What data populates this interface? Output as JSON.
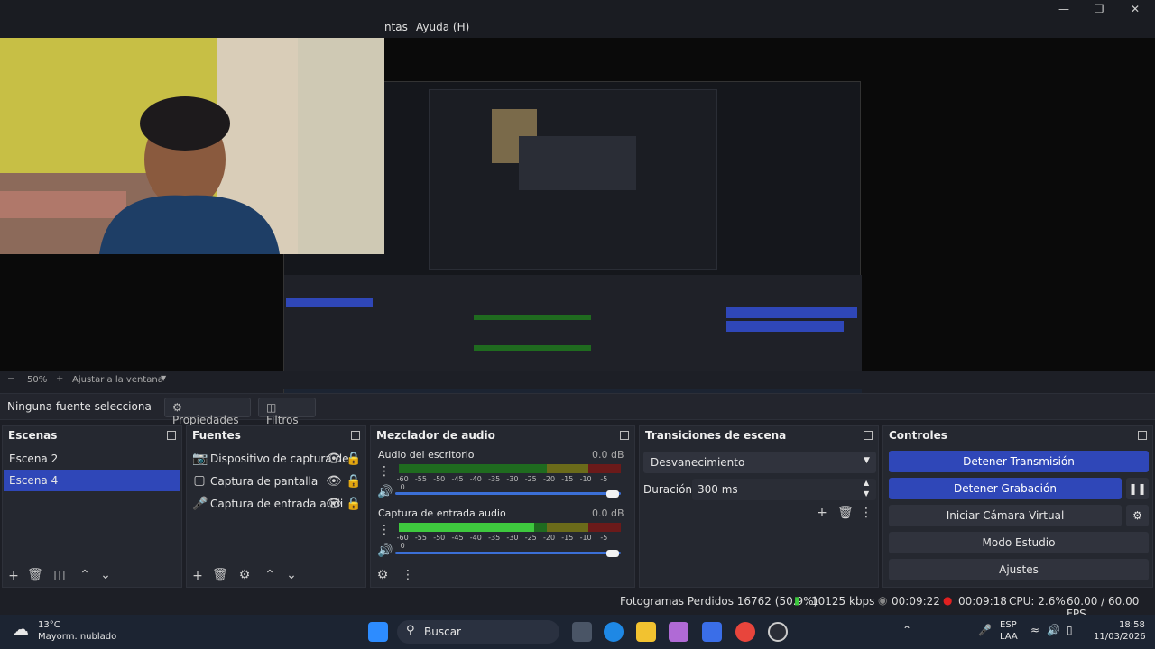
{
  "menu": {
    "partial_windows": "ntas",
    "help": "Ayuda (H)"
  },
  "zoom": {
    "value": "50%",
    "fit_label": "Ajustar a la ventana"
  },
  "source_bar": {
    "no_source": "Ninguna fuente selecciona",
    "properties": "Propiedades",
    "filters": "Filtros"
  },
  "scenes": {
    "title": "Escenas",
    "items": [
      "Escena 2",
      "Escena 4"
    ],
    "selected": "Escena 4"
  },
  "sources": {
    "title": "Fuentes",
    "items": [
      {
        "label": "Dispositivo de captura de",
        "icon": "camera-icon"
      },
      {
        "label": "Captura de pantalla",
        "icon": "monitor-icon"
      },
      {
        "label": "Captura de entrada audi",
        "icon": "microphone-icon"
      }
    ]
  },
  "mixer": {
    "title": "Mezclador de audio",
    "ticks": [
      "-60",
      "-55",
      "-50",
      "-45",
      "-40",
      "-35",
      "-30",
      "-25",
      "-20",
      "-15",
      "-10",
      "-5",
      "0"
    ],
    "channels": [
      {
        "name": "Audio del escritorio",
        "db": "0.0 dB",
        "level": 0.0
      },
      {
        "name": "Captura de entrada audio",
        "db": "0.0 dB",
        "level": 0.6
      }
    ]
  },
  "transitions": {
    "title": "Transiciones de escena",
    "selected": "Desvanecimiento",
    "duration_label": "Duración",
    "duration_value": "300 ms"
  },
  "controls": {
    "title": "Controles",
    "stop_stream": "Detener Transmisión",
    "stop_record": "Detener Grabación",
    "virtual_cam": "Iniciar Cámara Virtual",
    "studio_mode": "Modo Estudio",
    "settings": "Ajustes"
  },
  "status": {
    "dropped": "Fotogramas Perdidos 16762 (50.9%)",
    "kbps": "10125 kbps",
    "stream_time": "00:09:22",
    "rec_time": "00:09:18",
    "cpu": "CPU: 2.6%",
    "fps": "60.00 / 60.00 FPS"
  },
  "taskbar": {
    "weather_temp": "13°C",
    "weather_desc": "Mayorm. nublado",
    "search": "Buscar",
    "lang1": "ESP",
    "lang2": "LAA",
    "time": "18:58",
    "date": "11/03/2026"
  },
  "colors": {
    "accent": "#2f47b8",
    "bg": "#1d1f26",
    "panel": "#252830"
  }
}
